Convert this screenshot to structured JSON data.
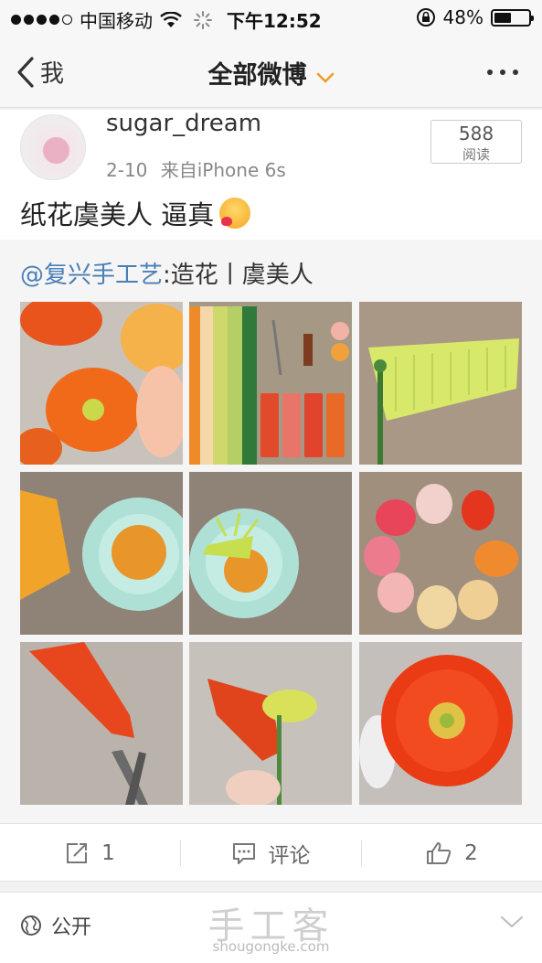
{
  "status_bar": {
    "carrier": "中国移动",
    "time": "下午12:52",
    "battery_percent": "48%",
    "battery_level": 0.48
  },
  "nav": {
    "back_label": "我",
    "title": "全部微博",
    "accent_color": "#f29b26"
  },
  "post": {
    "username": "sugar_dream",
    "date": "2-10",
    "source": "来自iPhone 6s",
    "read_count": "588",
    "read_label": "阅读",
    "text": "纸花虞美人 逼真",
    "repost": {
      "mention": "@复兴手工艺",
      "text": ":造花丨虞美人",
      "mention_color": "#4a7fb5"
    },
    "images": [
      "orange-poppies-photo",
      "crepe-paper-and-paints-photo",
      "fringed-green-paper-photo",
      "bowl-with-orange-pollen-photo",
      "stamen-in-bowl-photo",
      "petal-circle-photo",
      "folding-petal-photo",
      "poppy-assembly-photo",
      "finished-red-poppy-photo"
    ]
  },
  "actions": {
    "repost_count": "1",
    "comment_label": "评论",
    "like_count": "2"
  },
  "footer": {
    "visibility": "公开",
    "watermark_cn": "手工客",
    "watermark_url": "shougongke.com"
  }
}
